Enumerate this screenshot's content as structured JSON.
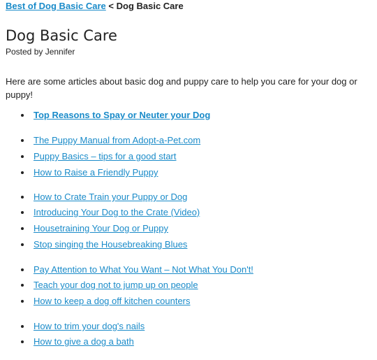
{
  "breadcrumb": {
    "parent_link": "Best of Dog Basic Care",
    "separator": "<",
    "current": "Dog Basic Care"
  },
  "article": {
    "title": "Dog Basic Care",
    "byline": "Posted by Jennifer",
    "intro": "Here are some articles about basic dog and puppy care to help you care for your dog or puppy!"
  },
  "links": [
    "Top Reasons to Spay or Neuter your Dog",
    "The Puppy Manual from Adopt-a-Pet.com",
    "Puppy Basics – tips for a good start",
    "How to Raise a Friendly Puppy",
    "How to Crate Train your Puppy or Dog",
    "Introducing Your Dog to the Crate (Video)",
    "Housetraining Your Dog or Puppy",
    "Stop singing the Housebreaking Blues",
    "Pay Attention to What You Want – Not What You Don't!",
    "Teach your dog not to jump up on people",
    "How to keep a dog off kitchen counters",
    "How to trim your dog's nails",
    "How to give a dog a bath"
  ]
}
